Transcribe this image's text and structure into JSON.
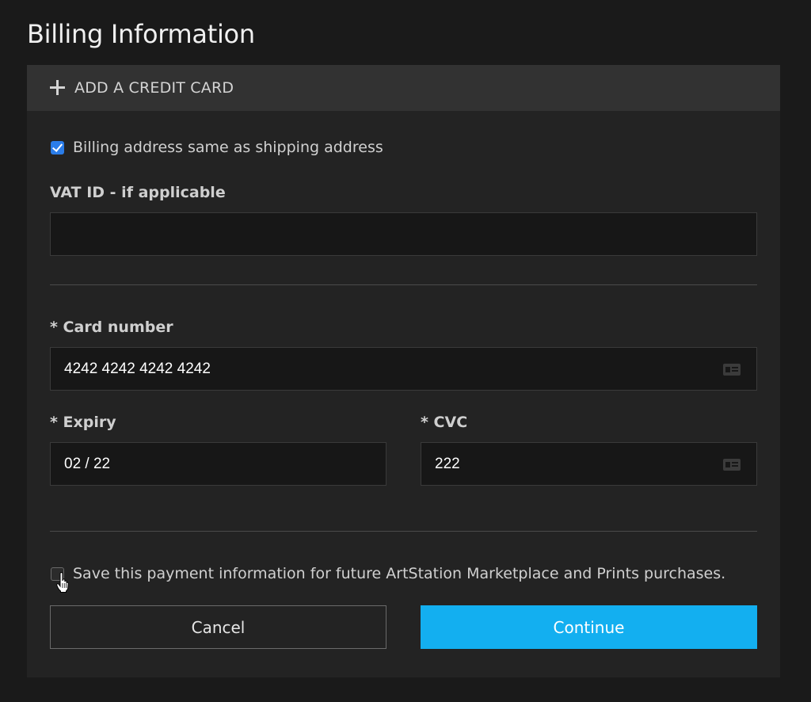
{
  "page": {
    "title": "Billing Information"
  },
  "card_header": {
    "icon": "plus-icon",
    "label": "ADD A CREDIT CARD"
  },
  "billing_same_as_shipping": {
    "checked": true,
    "label": "Billing address same as shipping address"
  },
  "vat": {
    "label": "VAT ID - if applicable",
    "value": ""
  },
  "card_number": {
    "label": "* Card number",
    "value": "4242 4242 4242 4242",
    "icon": "credit-card-icon"
  },
  "expiry": {
    "label": "* Expiry",
    "value": "02 / 22"
  },
  "cvc": {
    "label": "* CVC",
    "value": "222",
    "icon": "credit-card-icon"
  },
  "save_payment": {
    "checked": false,
    "label": "Save this payment information for future ArtStation Marketplace and Prints purchases."
  },
  "buttons": {
    "cancel": "Cancel",
    "continue": "Continue"
  },
  "colors": {
    "accent": "#13aff0",
    "checkbox_checked": "#2b7de9",
    "background": "#1a1a1a",
    "card_background": "#232323",
    "header_background": "#323232"
  }
}
